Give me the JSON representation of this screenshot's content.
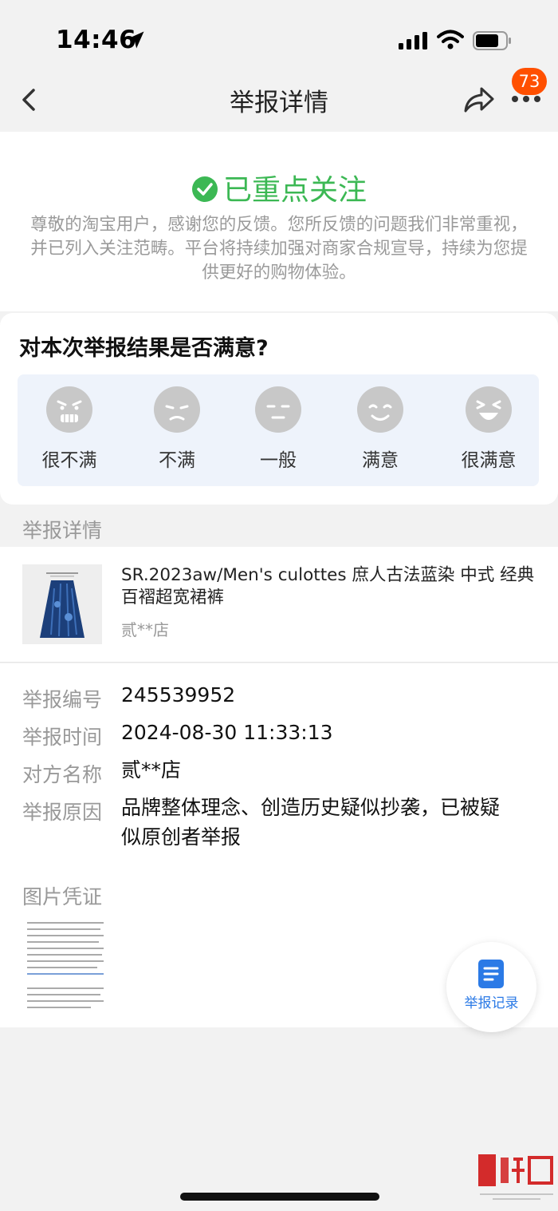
{
  "status_bar": {
    "time": "14:46"
  },
  "nav": {
    "title": "举报详情",
    "badge_count": "73"
  },
  "result": {
    "title": "已重点关注",
    "description": "尊敬的淘宝用户，感谢您的反馈。您所反馈的问题我们非常重视，并已列入关注范畴。平台将持续加强对商家合规宣导，持续为您提供更好的购物体验。"
  },
  "survey": {
    "question": "对本次举报结果是否满意?",
    "options": [
      {
        "label": "很不满",
        "icon": "angry-face-icon"
      },
      {
        "label": "不满",
        "icon": "unhappy-face-icon"
      },
      {
        "label": "一般",
        "icon": "neutral-face-icon"
      },
      {
        "label": "满意",
        "icon": "smile-face-icon"
      },
      {
        "label": "很满意",
        "icon": "laugh-face-icon"
      }
    ]
  },
  "report_section_label": "举报详情",
  "product": {
    "name": "SR.2023aw/Men's culottes 庶人古法蓝染 中式 经典百褶超宽裙裤",
    "shop": "贰**店"
  },
  "details": [
    {
      "key": "举报编号",
      "value": "245539952"
    },
    {
      "key": "举报时间",
      "value": "2024-08-30 11:33:13"
    },
    {
      "key": "对方名称",
      "value": "贰**店"
    },
    {
      "key": "举报原因",
      "value": "品牌整体理念、创造历史疑似抄袭，已被疑似原创者举报"
    }
  ],
  "evidence_label": "图片凭证",
  "float_button": {
    "label": "举报记录"
  },
  "colors": {
    "accent_green": "#3cb854",
    "badge_orange": "#ff5000",
    "link_blue": "#2b7ae6"
  }
}
